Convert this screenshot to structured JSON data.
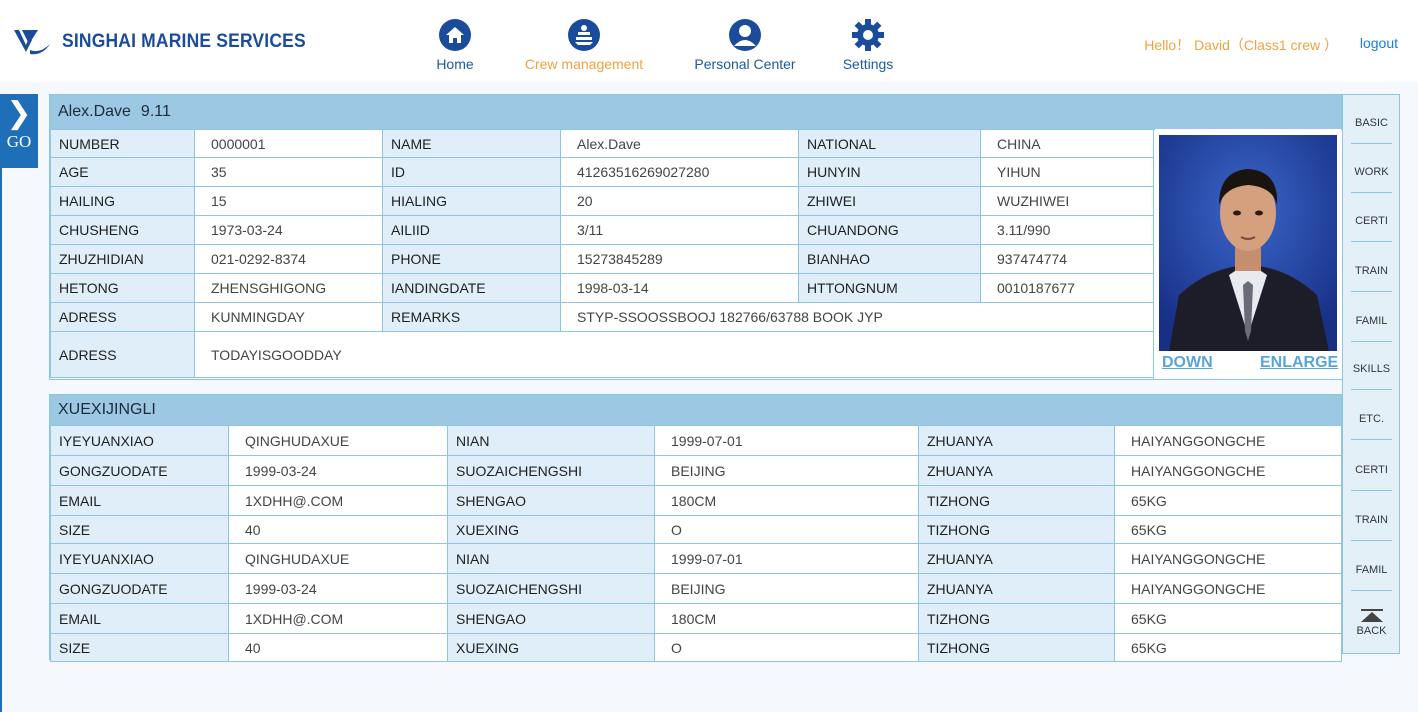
{
  "brand": {
    "name": "SINGHAI MARINE SERVICES"
  },
  "nav": [
    {
      "label": "Home",
      "icon": "home-icon",
      "active": false
    },
    {
      "label": "Crew management",
      "icon": "crew-icon",
      "active": true
    },
    {
      "label": "Personal Center",
      "icon": "user-icon",
      "active": false
    },
    {
      "label": "Settings",
      "icon": "gear-icon",
      "active": false
    }
  ],
  "user": {
    "greeting": "Hello！ David（Class1 crew ）",
    "logout": "logout"
  },
  "sidetab": {
    "go": "GO"
  },
  "profile": {
    "title_name": "Alex.Dave",
    "title_num": "9.11",
    "rows": [
      [
        "NUMBER",
        "0000001",
        "NAME",
        "Alex.Dave",
        "NATIONAL",
        "CHINA"
      ],
      [
        "AGE",
        "35",
        "ID",
        "41263516269027280",
        "HUNYIN",
        "YIHUN"
      ],
      [
        "HAILING",
        "15",
        "HIALING",
        "20",
        "ZHIWEI",
        "WUZHIWEI"
      ],
      [
        "CHUSHENG",
        "1973-03-24",
        "AILIID",
        "3/11",
        "CHUANDONG",
        "3.11/990"
      ],
      [
        "ZHUZHIDIAN",
        "021-0292-8374",
        "PHONE",
        "15273845289",
        "BIANHAO",
        "937474774"
      ],
      [
        "HETONG",
        "ZHENSGHIGONG",
        "IANDINGDATE",
        "1998-03-14",
        "HTTONGNUM",
        "0010187677"
      ]
    ],
    "address1": {
      "label": "ADRESS",
      "value": "KUNMINGDAY",
      "remarks_label": "REMARKS",
      "remarks_value": "STYP-SSOOSSBOOJ 182766/63788 BOOK JYP"
    },
    "address2": {
      "label": "ADRESS",
      "value": "TODAYISGOODDAY"
    },
    "photo_actions": {
      "down": "DOWN",
      "enlarge": "ENLARGE"
    }
  },
  "study": {
    "title": "XUEXIJINGLI",
    "rows": [
      [
        "IYEYUANXIAO",
        "QINGHUDAXUE",
        "NIAN",
        "1999-07-01",
        "ZHUANYA",
        "HAIYANGGONGCHE"
      ],
      [
        "GONGZUODATE",
        "1999-03-24",
        "SUOZAICHENGSHI",
        "BEIJING",
        "ZHUANYA",
        "HAIYANGGONGCHE"
      ],
      [
        "EMAIL",
        "1XDHH@.COM",
        "SHENGAO",
        "180CM",
        "TIZHONG",
        "65KG"
      ],
      [
        "SIZE",
        "40",
        "XUEXING",
        "O",
        "TIZHONG",
        "65KG"
      ],
      [
        "IYEYUANXIAO",
        "QINGHUDAXUE",
        "NIAN",
        "1999-07-01",
        "ZHUANYA",
        "HAIYANGGONGCHE"
      ],
      [
        "GONGZUODATE",
        "1999-03-24",
        "SUOZAICHENGSHI",
        "BEIJING",
        "ZHUANYA",
        "HAIYANGGONGCHE"
      ],
      [
        "EMAIL",
        "1XDHH@.COM",
        "SHENGAO",
        "180CM",
        "TIZHONG",
        "65KG"
      ],
      [
        "SIZE",
        "40",
        "XUEXING",
        "O",
        "TIZHONG",
        "65KG"
      ]
    ]
  },
  "side_nav": [
    "BASIC",
    "WORK",
    "CERTI",
    "TRAIN",
    "FAMIL",
    "SKILLS",
    "ETC.",
    "CERTI",
    "TRAIN",
    "FAMIL"
  ],
  "back": "BACK",
  "colors": {
    "brand": "#1b4c9c",
    "accent": "#f0a340",
    "header_band": "#9cc8e4",
    "label_bg": "#dfeef8",
    "border": "#8cc6e2"
  }
}
